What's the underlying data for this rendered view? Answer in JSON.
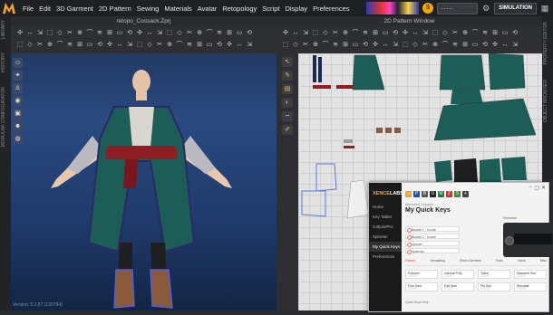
{
  "menu": {
    "logo": "marvelous-logo",
    "items": [
      "File",
      "Edit",
      "3D Garment",
      "2D Pattern",
      "Sewing",
      "Materials",
      "Avatar",
      "Retopology",
      "Script",
      "Display",
      "Preferences"
    ],
    "simulation_label": "SIMULATION",
    "coin_label": "$",
    "pill_text": "........"
  },
  "left_strip_labels": [
    "LIBRARY",
    "HISTORY",
    "MODULAR CONFIGURATOR"
  ],
  "right_strip_labels": [
    "PROPERTY EDITOR",
    "OBJECT BROWSER"
  ],
  "view3d": {
    "title": "retopo_Cossack.Zprj",
    "version": "Version: 5.1.87 (130794)"
  },
  "view2d": {
    "title": "2D Pattern Window"
  },
  "app": {
    "brand_a": "XENCE",
    "brand_b": "LABS",
    "nav": [
      "Home",
      "Key Tablet",
      "S.Bjolo/Pro",
      "Xplorian",
      "My Quick Keys",
      "Preferences"
    ],
    "nav_active_index": 4,
    "breadcrumb": "Marvelous Designer",
    "title": "My Quick Keys",
    "keys_list": [
      "Bundle 1 · Xcode",
      "Bundle 2 · Xcane",
      "Xpower",
      "Xpanvas"
    ],
    "device_label": "Keyboard",
    "tabs": [
      "Pattern",
      "Simulating",
      "Show Garment",
      "Tools",
      "Hand",
      "Misc"
    ],
    "active_tab_index": 0,
    "cards": [
      {
        "label": "Polygon",
        "row": 0
      },
      {
        "label": "Internal Poly",
        "row": 0
      },
      {
        "label": "Trace",
        "row": 0
      },
      {
        "label": "Segment Seo",
        "row": 0
      },
      {
        "label": "Free Sew",
        "row": 1
      },
      {
        "label": "Edit Sew",
        "row": 1
      },
      {
        "label": "Pin Seo",
        "row": 1
      },
      {
        "label": "Simulate",
        "row": 1
      }
    ],
    "footer": "Quick Keys Help"
  }
}
